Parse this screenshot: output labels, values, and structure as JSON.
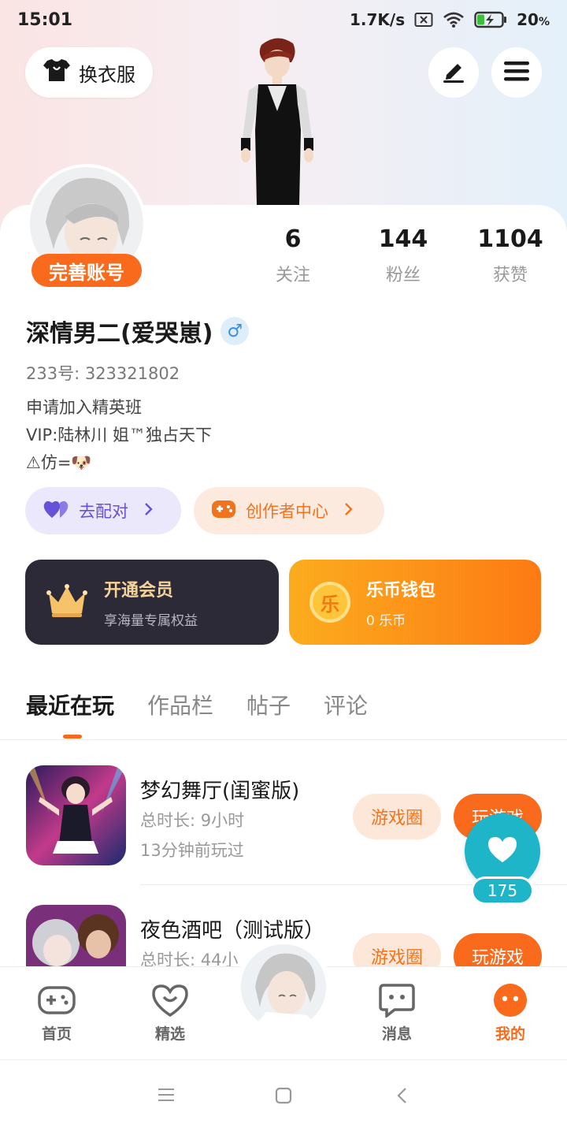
{
  "status": {
    "time": "15:01",
    "network_speed": "1.7K/s",
    "battery": "20",
    "battery_unit": "%"
  },
  "header": {
    "outfit_label": "换衣服"
  },
  "profile": {
    "complete_account_label": "完善账号",
    "stats": [
      {
        "value": "6",
        "label": "关注"
      },
      {
        "value": "144",
        "label": "粉丝"
      },
      {
        "value": "1104",
        "label": "获赞"
      }
    ],
    "username": "深情男二(爱哭崽)",
    "gender_symbol": "♂",
    "uid": "233号: 323321802",
    "bio_lines": [
      "申请加入精英班",
      "VIP:陆林川 姐™独占天下",
      "⚠仿=🐶"
    ]
  },
  "actions": {
    "match_label": "去配对",
    "creator_label": "创作者中心"
  },
  "cards": {
    "vip_title": "开通会员",
    "vip_subtitle": "享海量专属权益",
    "wallet_title": "乐币钱包",
    "wallet_subtitle": "0 乐币",
    "wallet_coin_char": "乐"
  },
  "tabs": [
    "最近在玩",
    "作品栏",
    "帖子",
    "评论"
  ],
  "games": [
    {
      "title": "梦幻舞厅(闺蜜版)",
      "duration": "总时长: 9小时",
      "last_played": "13分钟前玩过",
      "circle_label": "游戏圈",
      "play_label": "玩游戏"
    },
    {
      "title": "夜色酒吧（测试版）",
      "duration": "总时长: 44小",
      "circle_label": "游戏圈",
      "play_label": "玩游戏"
    }
  ],
  "floating_like": {
    "count": "175"
  },
  "bottom_nav": [
    {
      "label": "首页"
    },
    {
      "label": "精选"
    },
    {
      "label": "消息"
    },
    {
      "label": "我的"
    }
  ],
  "colors": {
    "accent": "#fa6a1c",
    "teal": "#1fb5c8",
    "vip_card": "#2b2a36"
  }
}
